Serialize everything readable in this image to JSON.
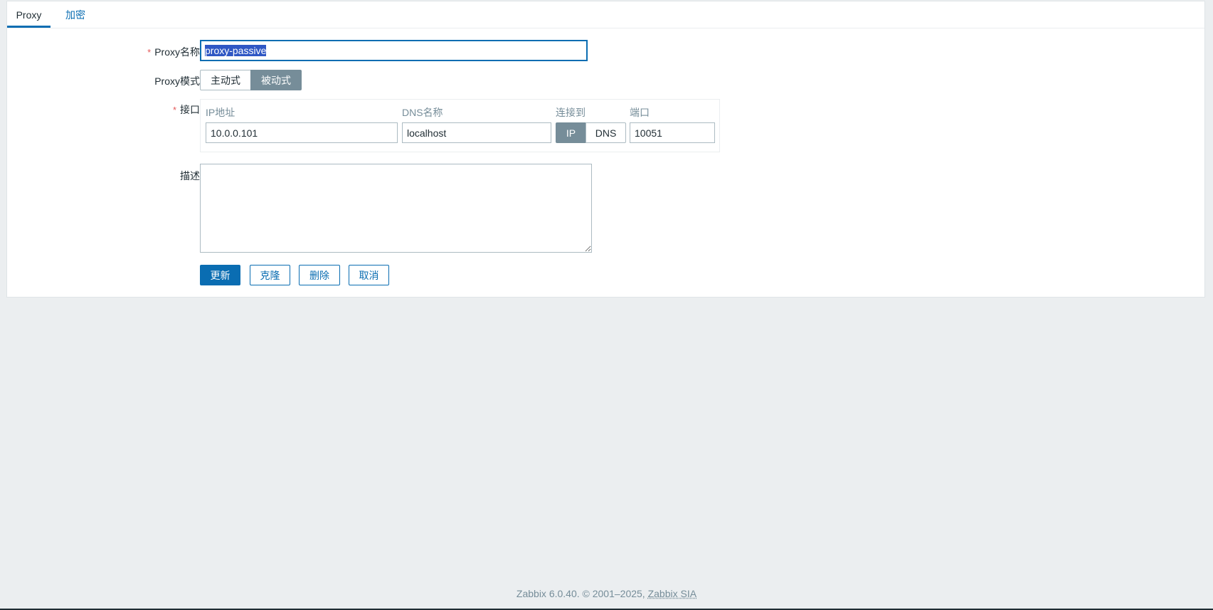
{
  "tabs": [
    {
      "label": "Proxy",
      "active": true
    },
    {
      "label": "加密",
      "active": false
    }
  ],
  "form": {
    "name_label": "Proxy名称",
    "name_value": "proxy-passive",
    "mode_label": "Proxy模式",
    "mode_options": [
      "主动式",
      "被动式"
    ],
    "mode_selected": "被动式",
    "interface_label": "接口",
    "interface": {
      "ip_header": "IP地址",
      "dns_header": "DNS名称",
      "connect_header": "连接到",
      "port_header": "端口",
      "ip_value": "10.0.0.101",
      "dns_value": "localhost",
      "connect_options": [
        "IP",
        "DNS"
      ],
      "connect_selected": "IP",
      "port_value": "10051"
    },
    "description_label": "描述",
    "description_value": "",
    "required_mark": "*"
  },
  "buttons": {
    "update": "更新",
    "clone": "克隆",
    "delete": "删除",
    "cancel": "取消"
  },
  "footer": {
    "text": "Zabbix 6.0.40. © 2001–2025, ",
    "link": "Zabbix SIA"
  },
  "colors": {
    "accent": "#0a6db2",
    "segment_on": "#768d99",
    "required": "#e45959",
    "background": "#ebeef0"
  }
}
